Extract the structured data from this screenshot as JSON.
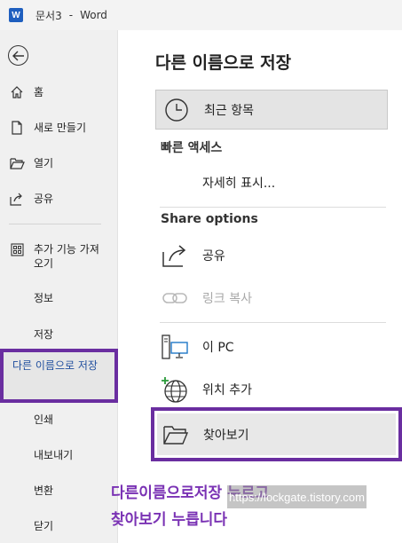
{
  "titlebar": {
    "app_badge": "W",
    "document": "문서3",
    "separator": "-",
    "app": "Word"
  },
  "sidebar": {
    "items": [
      {
        "label": "홈"
      },
      {
        "label": "새로 만들기"
      },
      {
        "label": "열기"
      },
      {
        "label": "공유"
      },
      {
        "label": "추가 기능 가져오기"
      },
      {
        "label": "정보"
      },
      {
        "label": "저장"
      },
      {
        "label": "다른 이름으로 저장"
      },
      {
        "label": "인쇄"
      },
      {
        "label": "내보내기"
      },
      {
        "label": "변환"
      },
      {
        "label": "닫기"
      }
    ]
  },
  "main": {
    "title": "다른 이름으로 저장",
    "recent_label": "최근 항목",
    "quick_access": "빠른 액세스",
    "show_details": "자세히 표시...",
    "share_options": "Share options",
    "share": "공유",
    "copy_link": "링크 복사",
    "this_pc": "이 PC",
    "add_place": "위치 추가",
    "browse": "찾아보기"
  },
  "annotation": {
    "caption_line1": "다른이름으로저장 누르고",
    "caption_line2": "찾아보기 누릅니다",
    "watermark": "https://lockgate.tistory.com"
  },
  "colors": {
    "highlight": "#6a2ea0",
    "selected_text": "#1f4e9e",
    "word_blue": "#1f5fbf"
  }
}
